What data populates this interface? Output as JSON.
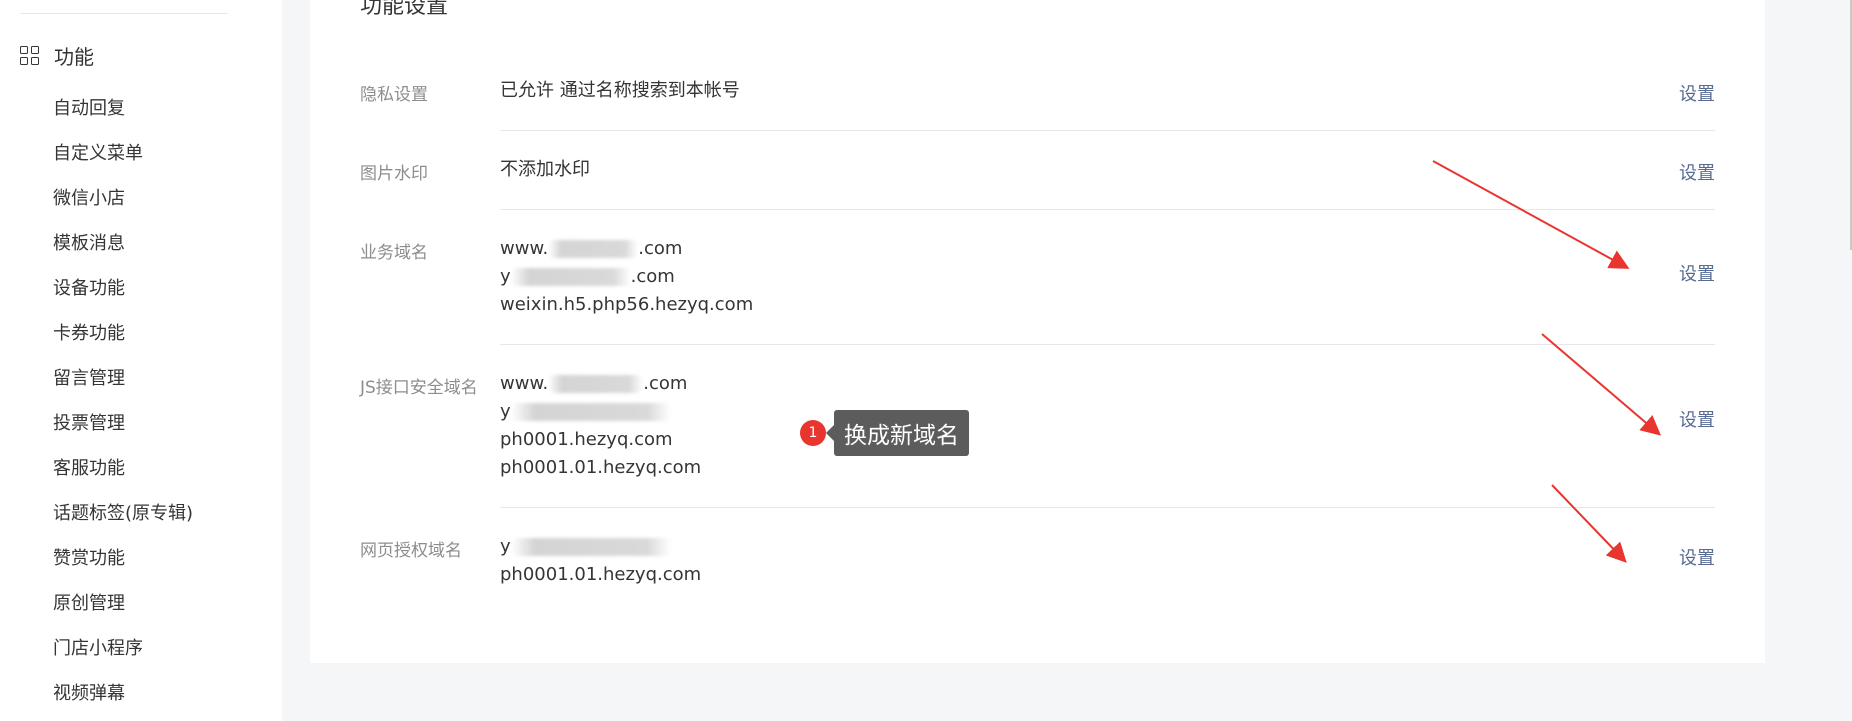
{
  "sidebar": {
    "section_label": "功能",
    "items": [
      {
        "label": "自动回复"
      },
      {
        "label": "自定义菜单"
      },
      {
        "label": "微信小店"
      },
      {
        "label": "模板消息"
      },
      {
        "label": "设备功能"
      },
      {
        "label": "卡券功能"
      },
      {
        "label": "留言管理"
      },
      {
        "label": "投票管理"
      },
      {
        "label": "客服功能"
      },
      {
        "label": "话题标签(原专辑)"
      },
      {
        "label": "赞赏功能"
      },
      {
        "label": "原创管理"
      },
      {
        "label": "门店小程序"
      },
      {
        "label": "视频弹幕"
      }
    ]
  },
  "panel": {
    "title": "功能设置",
    "action_label": "设置",
    "rows": [
      {
        "label": "隐私设置",
        "values": [
          "已允许 通过名称搜索到本帐号"
        ]
      },
      {
        "label": "图片水印",
        "values": [
          "不添加水印"
        ]
      },
      {
        "label": "业务域名",
        "values": [
          "www.",
          ".com",
          "y",
          ".com",
          "weixin.h5.php56.hezyq.com"
        ]
      },
      {
        "label": "JS接口安全域名",
        "values": [
          "www.",
          ".com",
          "y",
          "ph0001.hezyq.com",
          "ph0001.01.hezyq.com"
        ]
      },
      {
        "label": "网页授权域名",
        "values": [
          "y",
          "ph0001.01.hezyq.com"
        ]
      }
    ]
  },
  "callout": {
    "badge": "1",
    "text": "换成新域名"
  },
  "colors": {
    "link": "#576b95",
    "annotation": "#e8352f",
    "callout_bg": "#5c5c5c"
  }
}
